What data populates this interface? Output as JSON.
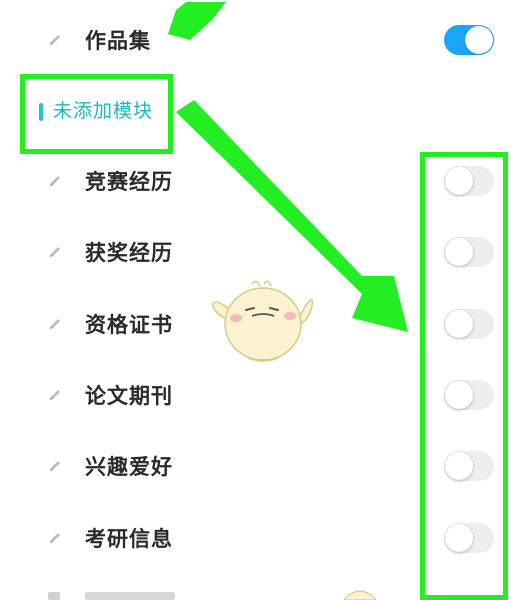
{
  "rows": [
    {
      "label": "作品集",
      "enabled": true
    },
    {
      "label": "竞赛经历",
      "enabled": false
    },
    {
      "label": "获奖经历",
      "enabled": false
    },
    {
      "label": "资格证书",
      "enabled": false
    },
    {
      "label": "论文期刊",
      "enabled": false
    },
    {
      "label": "兴趣爱好",
      "enabled": false
    },
    {
      "label": "考研信息",
      "enabled": false
    }
  ],
  "section_header": "未添加模块",
  "colors": {
    "toggle_on": "#1aa5f5",
    "toggle_off": "#eeeeee",
    "section_accent": "#19c8c8",
    "annotation_green": "#22ee22"
  },
  "icons": {
    "row_icon": "pencil-icon",
    "annotation": "arrow-icon"
  }
}
